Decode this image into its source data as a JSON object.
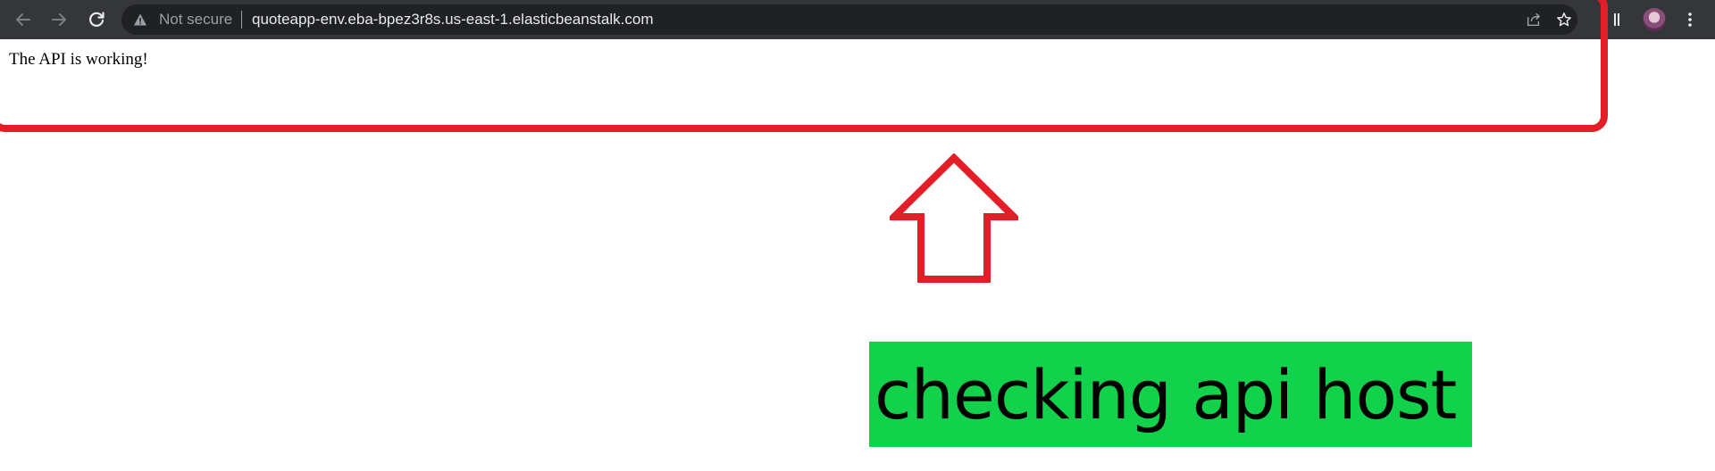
{
  "browser": {
    "address_bar": {
      "security_label": "Not secure",
      "url": "quoteapp-env.eba-bpez3r8s.us-east-1.elasticbeanstalk.com"
    },
    "icons": [
      "back-arrow-icon",
      "forward-arrow-icon",
      "reload-icon",
      "warning-icon",
      "share-icon",
      "star-icon",
      "extensions-icon",
      "profile-avatar",
      "menu-icon"
    ]
  },
  "page": {
    "body_text": "The API is working!"
  },
  "annotation": {
    "caption": "checking api host",
    "colors": {
      "highlight": "#e41e26",
      "caption_background": "#12d14b"
    }
  }
}
